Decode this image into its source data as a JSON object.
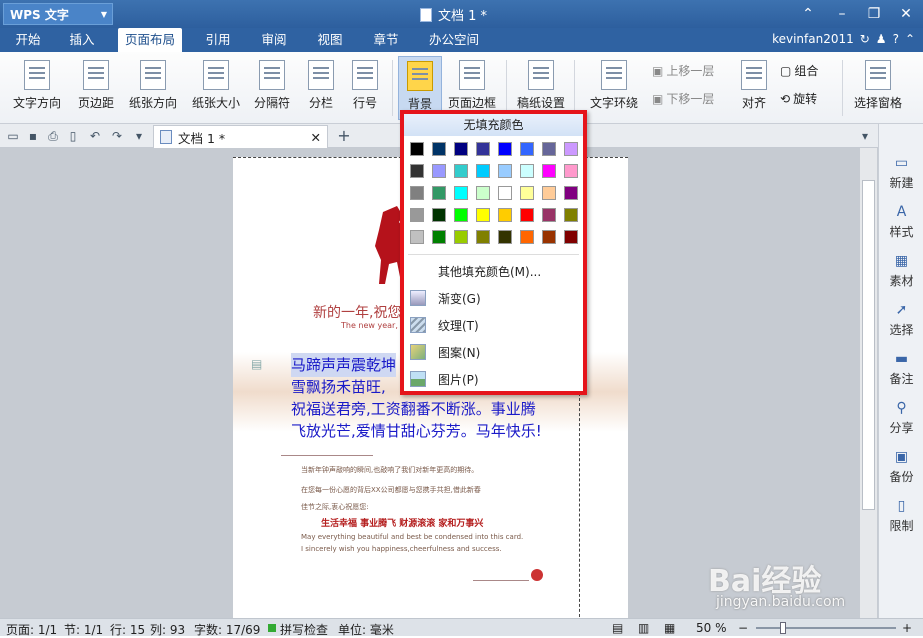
{
  "app": {
    "name": "WPS 文字",
    "doc_title": "文档 1 *",
    "user": "kevinfan2011"
  },
  "menu_tabs": [
    "开始",
    "插入",
    "页面布局",
    "引用",
    "审阅",
    "视图",
    "章节",
    "办公空间"
  ],
  "active_tab": "页面布局",
  "ribbon": {
    "text_direction": "文字方向",
    "margins": "页边距",
    "orientation": "纸张方向",
    "size": "纸张大小",
    "breaks": "分隔符",
    "columns": "分栏",
    "line_num": "行号",
    "background": "背景",
    "page_border": "页面边框",
    "paper_settings": "稿纸设置",
    "text_wrap": "文字环绕",
    "bring_forward": "上移一层",
    "send_backward": "下移一层",
    "align": "对齐",
    "group": "组合",
    "rotate": "旋转",
    "selection_pane": "选择窗格"
  },
  "doc_tab": {
    "title": "文档 1 *"
  },
  "sidebar": [
    "新建",
    "样式",
    "素材",
    "选择",
    "备注",
    "分享",
    "备份",
    "限制"
  ],
  "page": {
    "card_slogan": "新的一年,祝您合",
    "card_sub": "The new year, give you",
    "poem_lines": [
      "马蹄声声震乾坤",
      "雪飘扬禾苗旺,",
      "祝福送君旁,工资翻番不断涨。事业腾",
      "飞放光芒,爱情甘甜心芬芳。马年快乐!"
    ],
    "small_line1": "当新年钟声敲响的瞬间,也敲响了我们对新年更高的期待。",
    "small_line2": "在您每一份心愿的背后XX公司都愿与您携手共担,借此新春",
    "small_line3": "佳节之际,衷心祝愿您:",
    "wishes": "生活幸福  事业腾飞  财源滚滚  家和万事兴",
    "english1": "May everything beautiful and best be condensed into this card.",
    "english2": "I sincerely wish you happiness,cheerfulness and success."
  },
  "dropdown": {
    "no_fill": "无填充颜色",
    "more_colors": "其他填充颜色(M)...",
    "gradient": "渐变(G)",
    "texture": "纹理(T)",
    "pattern": "图案(N)",
    "picture": "图片(P)",
    "swatches": [
      "#000000",
      "#003366",
      "#000080",
      "#333399",
      "#0000ff",
      "#3366ff",
      "#666699",
      "#cc99ff",
      "#333333",
      "#9999ff",
      "#33cccc",
      "#00ccff",
      "#99ccff",
      "#ccffff",
      "#ff00ff",
      "#ff99cc",
      "#808080",
      "#339966",
      "#00ffff",
      "#ccffcc",
      "#ffffff",
      "#ffff99",
      "#ffcc99",
      "#800080",
      "#999999",
      "#003300",
      "#00ff00",
      "#ffff00",
      "#ffcc00",
      "#ff0000",
      "#993366",
      "#808000",
      "#c0c0c0",
      "#008000",
      "#99cc00",
      "#808000",
      "#333300",
      "#ff6600",
      "#993300",
      "#800000"
    ]
  },
  "status": {
    "page": "页面: 1/1",
    "section": "节: 1/1",
    "row": "行: 15",
    "col": "列: 93",
    "chars": "字数: 17/69",
    "spell": "拼写检查",
    "unit": "单位: 毫米",
    "zoom": "50 %"
  },
  "watermark": {
    "text": "Bai经验",
    "url": "jingyan.baidu.com"
  }
}
